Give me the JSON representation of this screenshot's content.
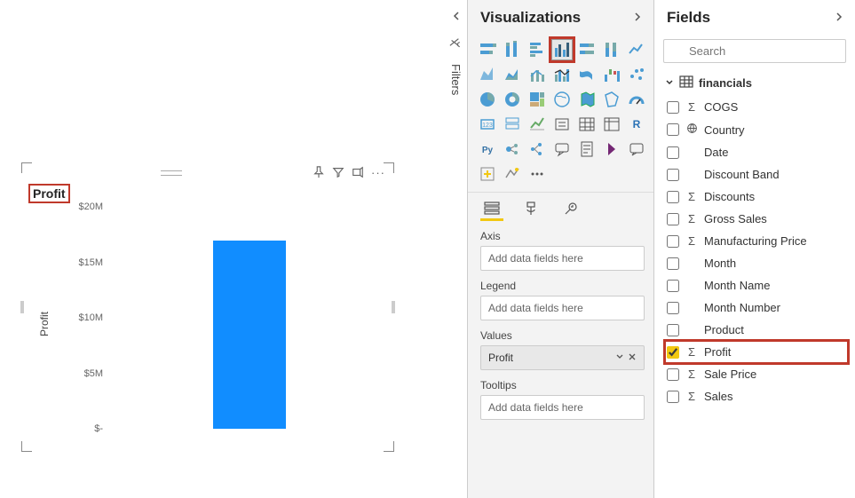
{
  "filters_rail": {
    "label": "Filters"
  },
  "viz_pane": {
    "title": "Visualizations",
    "tabs": {
      "fields": "Fields",
      "format": "Format",
      "analytics": "Analytics"
    },
    "wells": {
      "axis_label": "Axis",
      "axis_placeholder": "Add data fields here",
      "legend_label": "Legend",
      "legend_placeholder": "Add data fields here",
      "values_label": "Values",
      "values_field": "Profit",
      "tooltips_label": "Tooltips",
      "tooltips_placeholder": "Add data fields here"
    },
    "icons": [
      "stacked-bar",
      "stacked-column",
      "clustered-bar",
      "clustered-column",
      "stacked-bar-100",
      "stacked-column-100",
      "line",
      "area",
      "stacked-area",
      "line-stacked-column",
      "line-clustered-column",
      "ribbon",
      "waterfall",
      "scatter",
      "pie",
      "donut",
      "treemap",
      "map",
      "filled-map",
      "shape-map",
      "gauge",
      "card",
      "multi-row-card",
      "kpi",
      "slicer",
      "table",
      "matrix",
      "r",
      "python",
      "key-influencers",
      "decomposition",
      "qa",
      "paginated",
      "power-apps",
      "chat",
      "custom-1",
      "custom-2",
      "more"
    ],
    "selected_index": 3
  },
  "fields_pane": {
    "title": "Fields",
    "search_placeholder": "Search",
    "table": "financials",
    "items": [
      {
        "name": "COGS",
        "sigma": true,
        "checked": false,
        "icon": ""
      },
      {
        "name": "Country",
        "sigma": false,
        "checked": false,
        "icon": "globe"
      },
      {
        "name": "Date",
        "sigma": false,
        "checked": false,
        "icon": ""
      },
      {
        "name": "Discount Band",
        "sigma": false,
        "checked": false,
        "icon": ""
      },
      {
        "name": "Discounts",
        "sigma": true,
        "checked": false,
        "icon": ""
      },
      {
        "name": "Gross Sales",
        "sigma": true,
        "checked": false,
        "icon": ""
      },
      {
        "name": "Manufacturing Price",
        "sigma": true,
        "checked": false,
        "icon": ""
      },
      {
        "name": "Month",
        "sigma": false,
        "checked": false,
        "icon": ""
      },
      {
        "name": "Month Name",
        "sigma": false,
        "checked": false,
        "icon": ""
      },
      {
        "name": "Month Number",
        "sigma": false,
        "checked": false,
        "icon": ""
      },
      {
        "name": "Product",
        "sigma": false,
        "checked": false,
        "icon": ""
      },
      {
        "name": "Profit",
        "sigma": true,
        "checked": true,
        "icon": "",
        "highlight": true
      },
      {
        "name": "Sale Price",
        "sigma": true,
        "checked": false,
        "icon": ""
      },
      {
        "name": "Sales",
        "sigma": true,
        "checked": false,
        "icon": ""
      }
    ]
  },
  "visual": {
    "title": "Profit",
    "y_axis_title": "Profit"
  },
  "chart_data": {
    "type": "bar",
    "categories": [
      ""
    ],
    "values": [
      17000000
    ],
    "title": "Profit",
    "xlabel": "",
    "ylabel": "Profit",
    "ylim": [
      0,
      20000000
    ],
    "yticks": [
      {
        "label": "$20M",
        "value": 20000000
      },
      {
        "label": "$15M",
        "value": 15000000
      },
      {
        "label": "$10M",
        "value": 10000000
      },
      {
        "label": "$5M",
        "value": 5000000
      },
      {
        "label": "$-",
        "value": 0
      }
    ]
  }
}
